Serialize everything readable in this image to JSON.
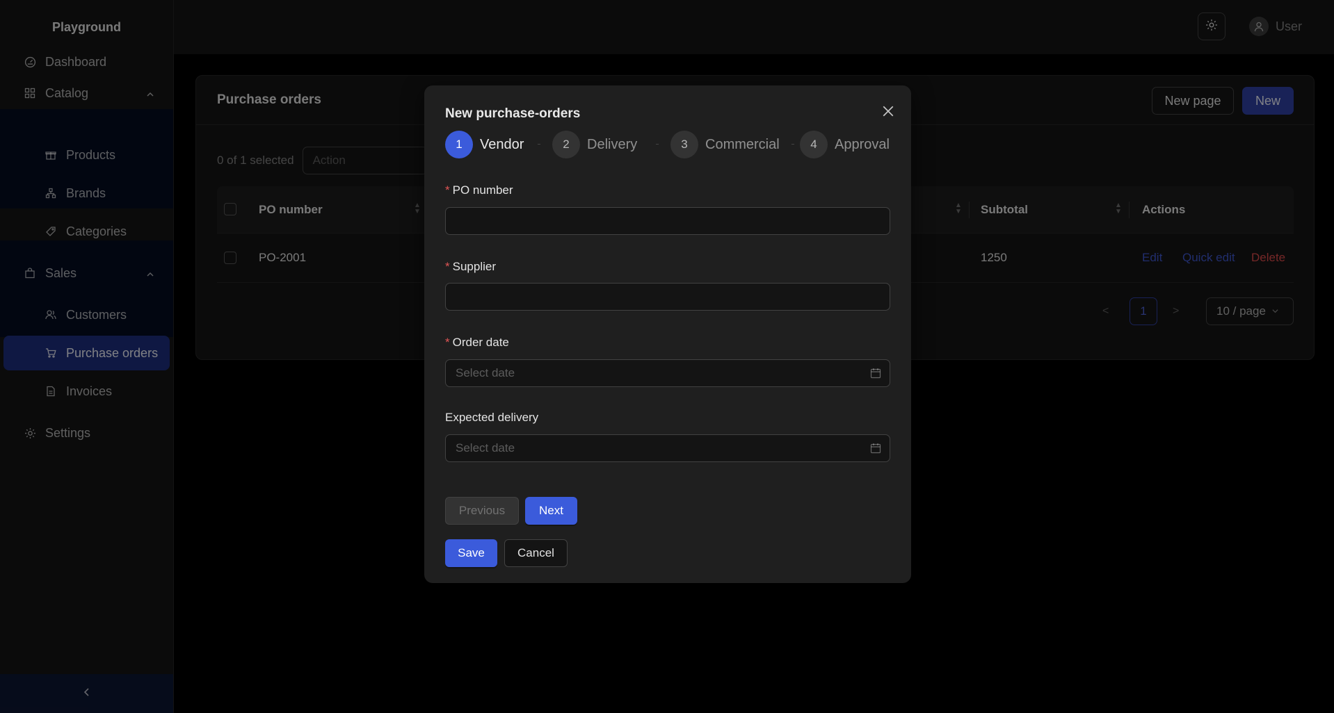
{
  "app": {
    "brand": "Playground"
  },
  "sidebar": {
    "items": [
      {
        "label": "Dashboard"
      },
      {
        "label": "Catalog"
      },
      {
        "label": "Products"
      },
      {
        "label": "Brands"
      },
      {
        "label": "Categories"
      },
      {
        "label": "Sales"
      },
      {
        "label": "Customers"
      },
      {
        "label": "Purchase orders"
      },
      {
        "label": "Invoices"
      },
      {
        "label": "Settings"
      }
    ],
    "active": "Purchase orders"
  },
  "header": {
    "user_label": "User"
  },
  "page": {
    "title": "Purchase orders",
    "new_page_label": "New page",
    "new_label": "New",
    "selection_text": "0 of 1 selected",
    "action_placeholder": "Action"
  },
  "table": {
    "columns": [
      "PO number",
      "Subtotal",
      "Actions"
    ],
    "rows": [
      {
        "po_number": "PO-2001",
        "subtotal": "1250"
      }
    ],
    "row_actions": {
      "edit": "Edit",
      "quick_edit": "Quick edit",
      "delete": "Delete"
    }
  },
  "pagination": {
    "prev": "<",
    "current": "1",
    "next": ">",
    "page_size": "10 / page"
  },
  "modal": {
    "title": "New purchase-orders",
    "steps": [
      {
        "num": "1",
        "label": "Vendor"
      },
      {
        "num": "2",
        "label": "Delivery"
      },
      {
        "num": "3",
        "label": "Commercial"
      },
      {
        "num": "4",
        "label": "Approval"
      }
    ],
    "current_step": 1,
    "fields": {
      "po_number": {
        "label": "PO number",
        "required_mark": "*",
        "value": ""
      },
      "supplier": {
        "label": "Supplier",
        "required_mark": "*",
        "value": ""
      },
      "order_date": {
        "label": "Order date",
        "required_mark": "*",
        "placeholder": "Select date"
      },
      "expected_delivery": {
        "label": "Expected delivery",
        "placeholder": "Select date"
      }
    },
    "previous_label": "Previous",
    "next_label": "Next",
    "save_label": "Save",
    "cancel_label": "Cancel"
  },
  "colors": {
    "accent": "#3b5bdb",
    "active_menu": "#1d2c7a",
    "danger": "#d84a4a",
    "link": "#3d55c9"
  },
  "icons": {
    "dashboard": "dashboard-icon",
    "catalog": "grid-icon",
    "products": "gift-icon",
    "brands": "cluster-icon",
    "categories": "tag-icon",
    "sales": "shopping-bag-icon",
    "customers": "users-icon",
    "purchase_orders": "cart-icon",
    "invoices": "file-icon",
    "settings": "gear-icon"
  }
}
